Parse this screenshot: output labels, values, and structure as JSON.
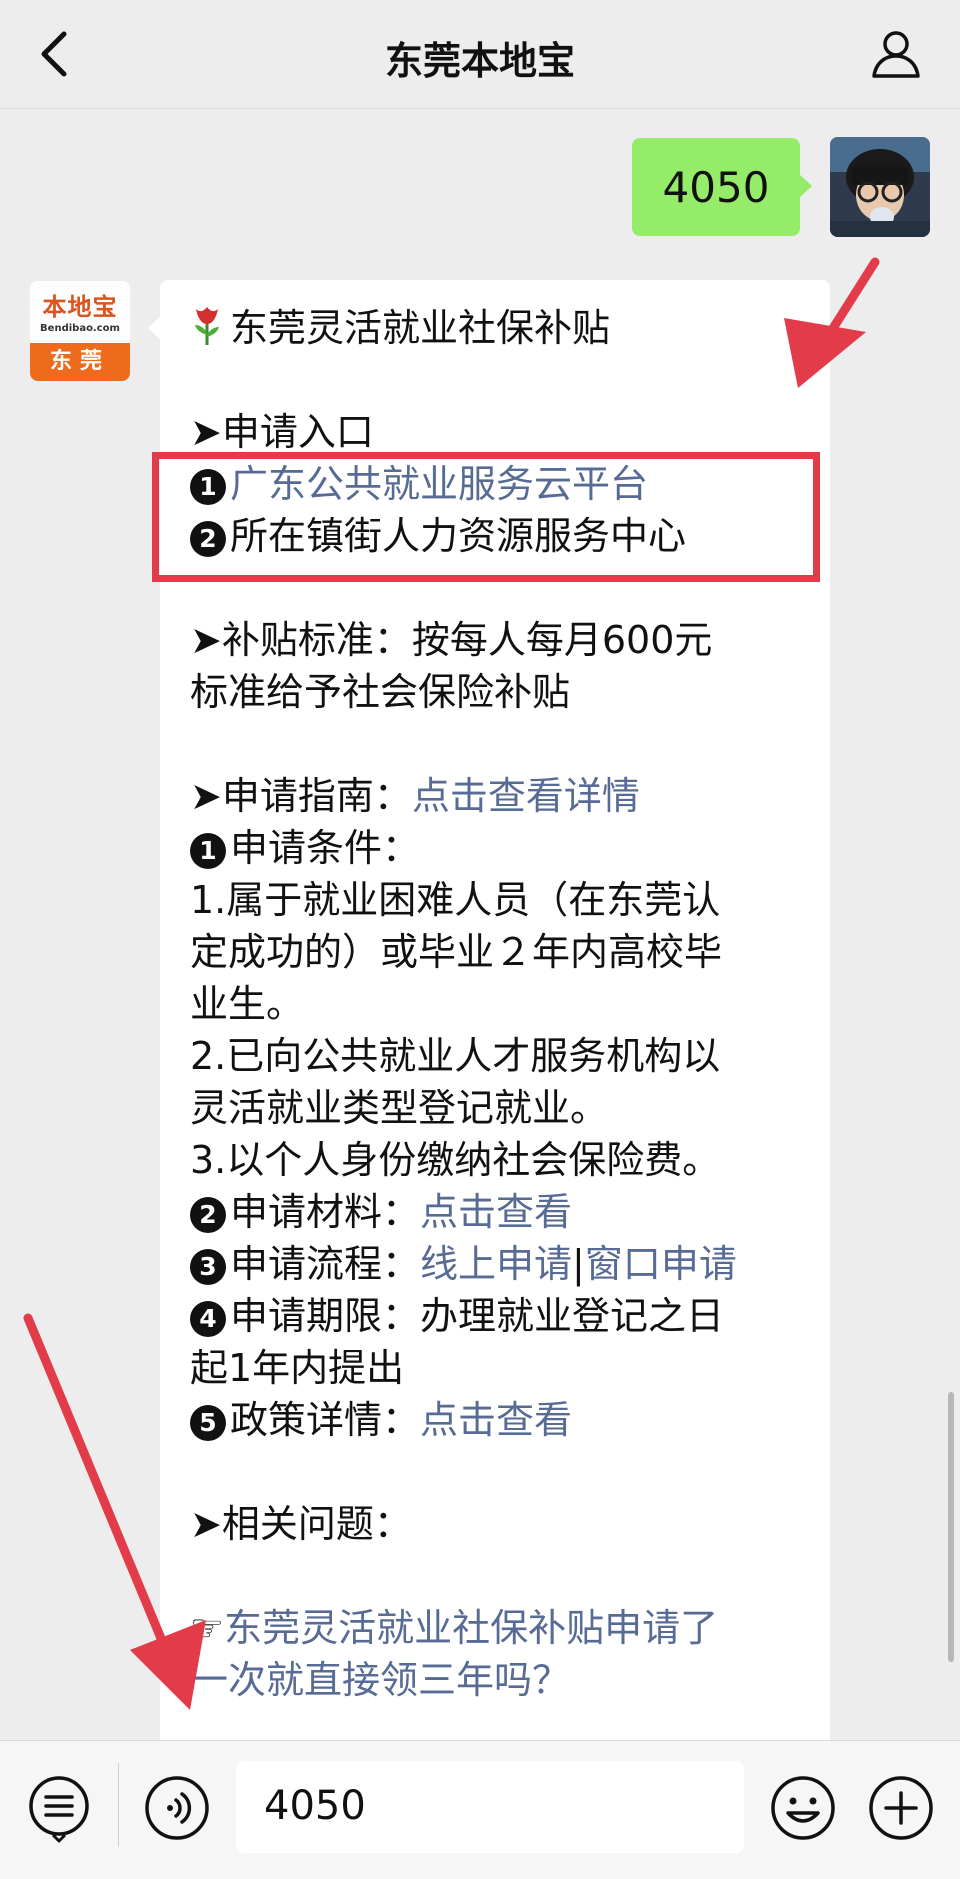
{
  "header": {
    "title": "东莞本地宝"
  },
  "outgoing": {
    "text": "4050"
  },
  "bot": {
    "logo_main": "本地宝",
    "logo_sub": "Bendibao.com",
    "logo_city": "东莞"
  },
  "message": {
    "title": "东莞灵活就业社保补贴",
    "entry_heading": "➤申请入口",
    "entry_1_num": "1",
    "entry_1": "广东公共就业服务云平台",
    "entry_2_num": "2",
    "entry_2": "所在镇街人力资源服务中心",
    "standard_line1": "➤补贴标准：按每人每月600元",
    "standard_line2": "标准给予社会保险补贴",
    "guide_label": "➤申请指南：",
    "guide_link": "点击查看详情",
    "cond_num": "1",
    "cond_label": "申请条件：",
    "cond_1a": "1.属于就业困难人员（在东莞认",
    "cond_1b": "定成功的）或毕业２年内高校毕",
    "cond_1c": "业生。",
    "cond_2a": "2.已向公共就业人才服务机构以",
    "cond_2b": "灵活就业类型登记就业。",
    "cond_3": "3.以个人身份缴纳社会保险费。",
    "mat_num": "2",
    "mat_label": "申请材料：",
    "mat_link": "点击查看",
    "flow_num": "3",
    "flow_label": "申请流程：",
    "flow_link1": "线上申请",
    "flow_sep": "|",
    "flow_link2": "窗口申请",
    "term_num": "4",
    "term_label": "申请期限：办理就业登记之日",
    "term_line2": "起1年内提出",
    "policy_num": "5",
    "policy_label": "政策详情：",
    "policy_link": "点击查看",
    "related": "➤相关问题：",
    "q_prefix": "☞",
    "q_line1": "东莞灵活就业社保补贴申请了",
    "q_line2": "一次就直接领三年吗？"
  },
  "composer": {
    "input_value": "4050"
  },
  "colors": {
    "bubble_out": "#95ec69",
    "link": "#576b95",
    "highlight": "#e23c4a",
    "background": "#ededed"
  },
  "icons": [
    "back-icon",
    "profile-icon",
    "menu-icon",
    "voice-icon",
    "emoji-icon",
    "plus-icon",
    "flower-icon"
  ]
}
